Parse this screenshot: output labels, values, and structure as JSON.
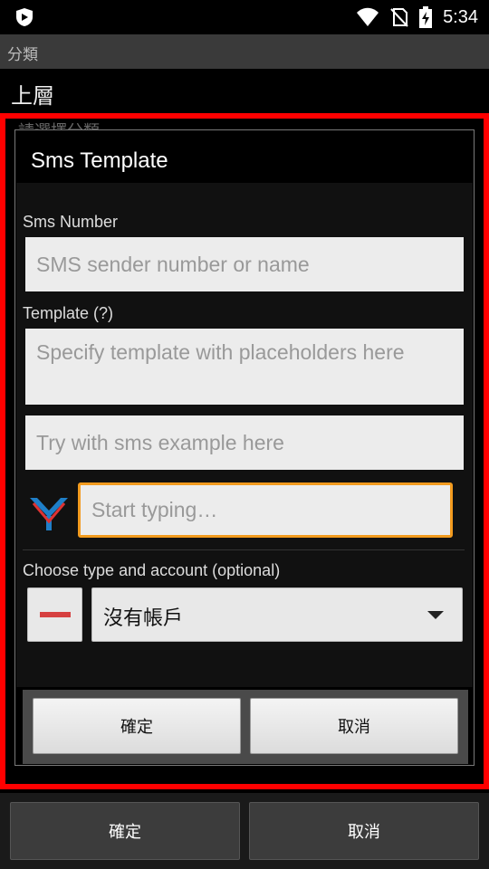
{
  "status_bar": {
    "time": "5:34"
  },
  "background": {
    "title": "分類",
    "parent_item": "上層",
    "ghost_hint": "請選擇分類...",
    "ok_label": "確定",
    "cancel_label": "取消"
  },
  "dialog": {
    "title": "Sms Template",
    "sms_number_label": "Sms Number",
    "sms_number_placeholder": "SMS sender number or name",
    "template_label": "Template (?)",
    "template_placeholder": "Specify template with placeholders here",
    "example_placeholder": "Try with sms example here",
    "typing_placeholder": "Start typing…",
    "account_label": "Choose type and account (optional)",
    "account_selected": "沒有帳戶",
    "ok_label": "確定",
    "cancel_label": "取消"
  },
  "colors": {
    "highlight": "#ff0000",
    "focus_border": "#f29b1f",
    "minus": "#d64040"
  },
  "icons": [
    "shield-icon",
    "wifi-icon",
    "no-sim-icon",
    "battery-charging-icon",
    "app-logo-icon",
    "minus-icon",
    "dropdown-arrow-icon"
  ]
}
